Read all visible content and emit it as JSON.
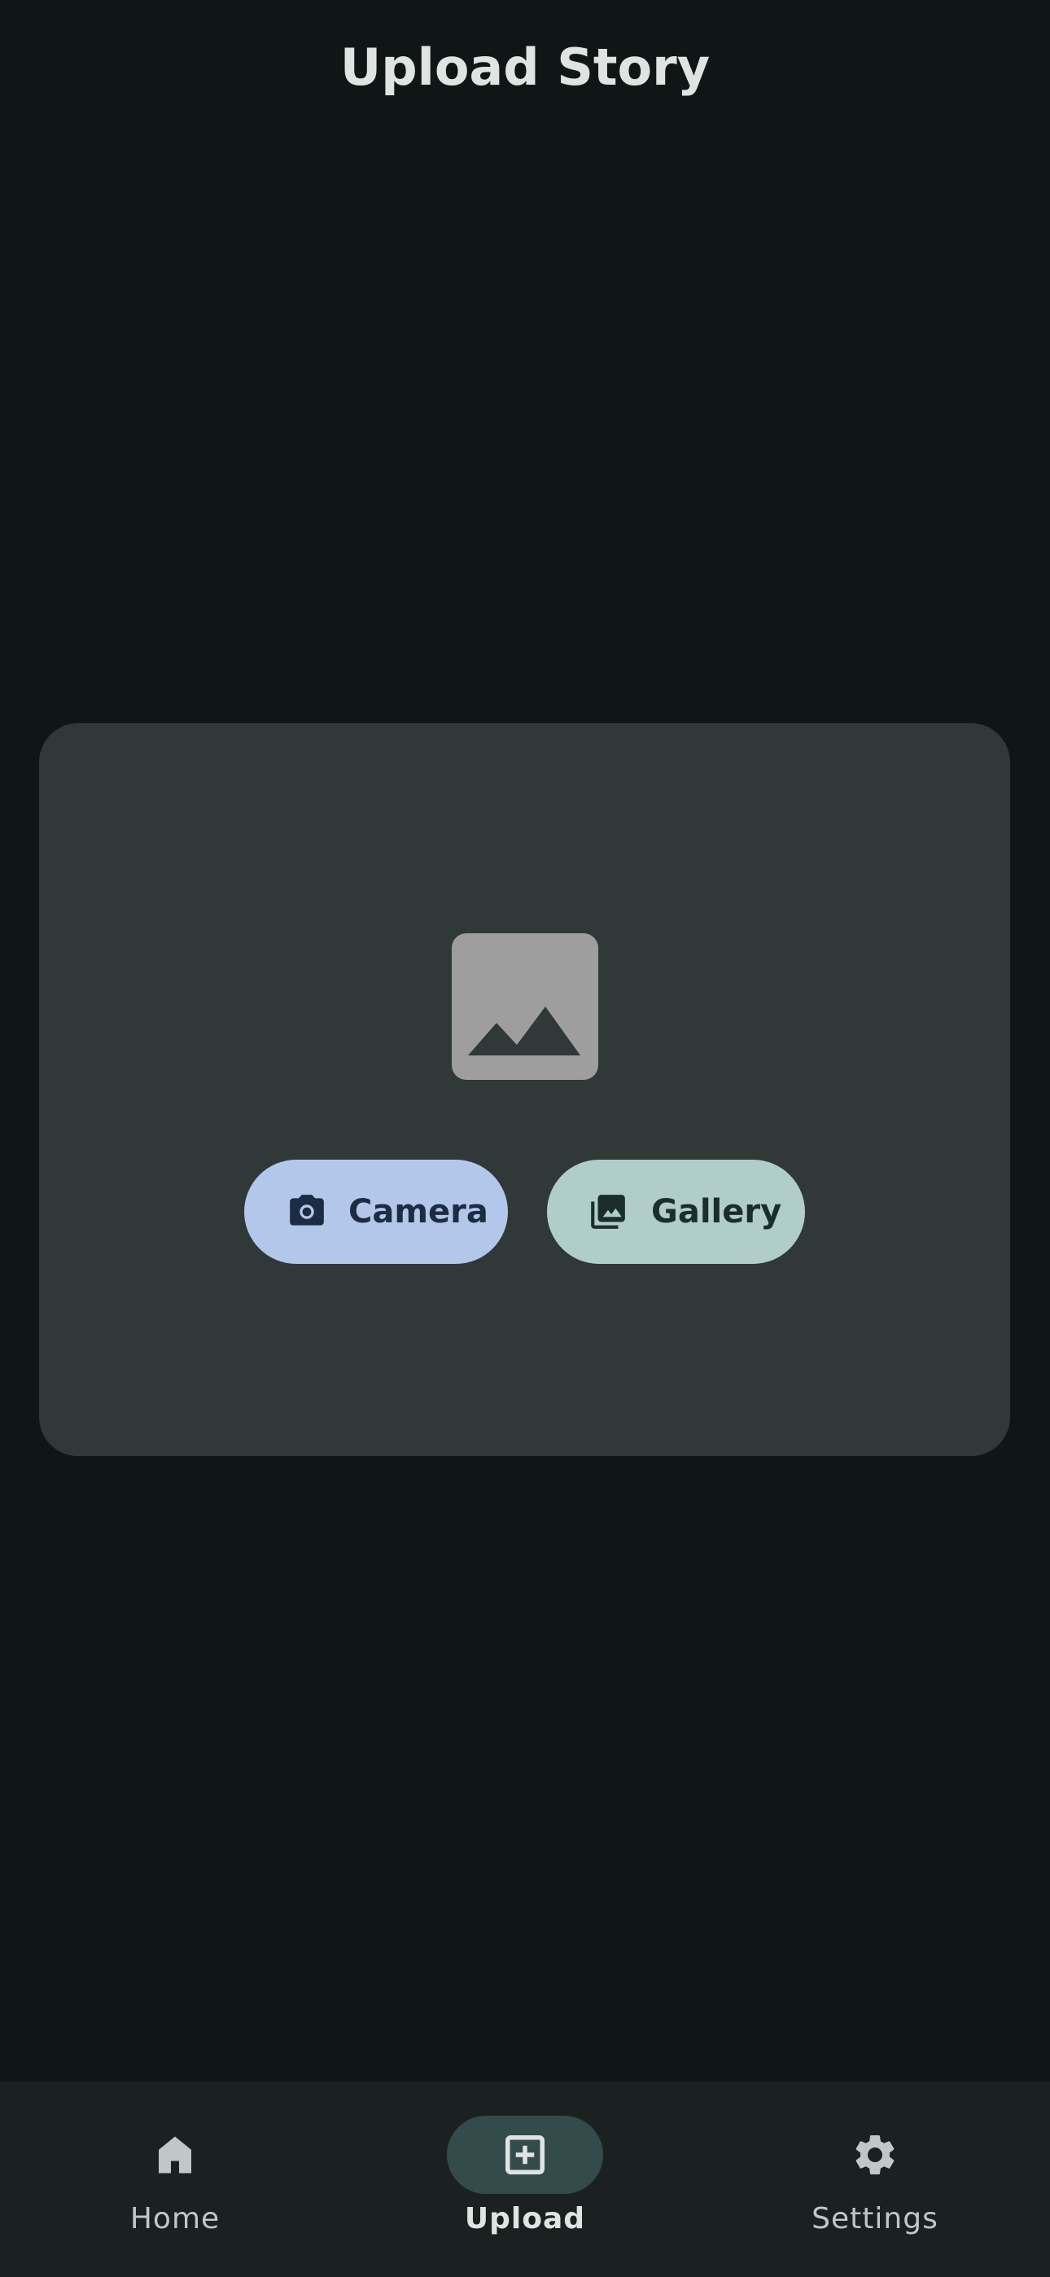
{
  "header": {
    "title": "Upload Story"
  },
  "upload_card": {
    "placeholder_icon": "image-placeholder-icon",
    "buttons": [
      {
        "label": "Camera",
        "icon": "camera-icon",
        "color": "#b3c7ea"
      },
      {
        "label": "Gallery",
        "icon": "photo-library-icon",
        "color": "#b1cdca"
      }
    ]
  },
  "nav": {
    "items": [
      {
        "label": "Home",
        "icon": "home-icon",
        "active": false
      },
      {
        "label": "Upload",
        "icon": "add-box-icon",
        "active": true
      },
      {
        "label": "Settings",
        "icon": "gear-icon",
        "active": false
      }
    ]
  },
  "colors": {
    "background": "#101616",
    "card": "#303838",
    "navbar": "#1b2020",
    "active_pill": "#334b4b"
  }
}
